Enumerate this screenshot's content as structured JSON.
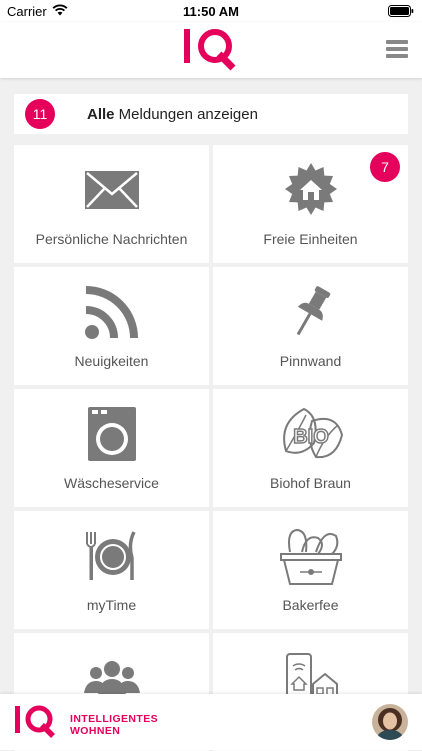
{
  "status_bar": {
    "carrier": "Carrier",
    "time": "11:50 AM"
  },
  "header": {
    "logo_text": "IQ"
  },
  "all_messages": {
    "count": "11",
    "label_bold": "Alle",
    "label_rest": " Meldungen anzeigen"
  },
  "tiles": [
    {
      "label": "Persönliche Nachrichten",
      "icon": "envelope-icon"
    },
    {
      "label": "Freie Einheiten",
      "icon": "house-seal-icon",
      "badge": "7"
    },
    {
      "label": "Neuigkeiten",
      "icon": "rss-feed-icon"
    },
    {
      "label": "Pinnwand",
      "icon": "pushpin-icon"
    },
    {
      "label": "Wäscheservice",
      "icon": "washing-machine-icon"
    },
    {
      "label": "Biohof Braun",
      "icon": "bio-leaf-icon"
    },
    {
      "label": "myTime",
      "icon": "plate-cutlery-icon"
    },
    {
      "label": "Bakerfee",
      "icon": "bread-basket-icon"
    },
    {
      "label": "",
      "icon": "community-group-icon"
    },
    {
      "label": "",
      "icon": "smart-home-icon"
    }
  ],
  "footer": {
    "brand_line1": "INTELLIGENTES",
    "brand_line2": "WOHNEN"
  },
  "colors": {
    "accent": "#e5005b",
    "icon_gray": "#7a7a7a",
    "background": "#f0f0f0"
  }
}
